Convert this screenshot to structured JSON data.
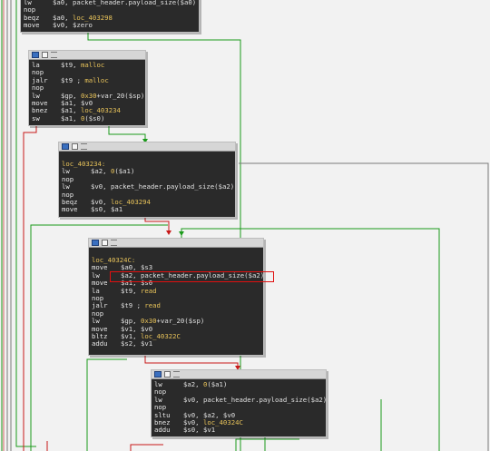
{
  "blocks": [
    {
      "id": "top",
      "lines": [
        {
          "m": "lw",
          "o": "$a0, packet_header.payload_size($a0)"
        },
        {
          "m": "nop",
          "o": ""
        },
        {
          "m": "beqz",
          "o": "$a0, loc_403298"
        },
        {
          "m": "move",
          "o": "$v0, $zero"
        }
      ]
    },
    {
      "id": "malloc",
      "lines": [
        {
          "m": "la",
          "o": "$t9, malloc"
        },
        {
          "m": "nop",
          "o": ""
        },
        {
          "m": "jalr",
          "o": "$t9 ; malloc"
        },
        {
          "m": "nop",
          "o": ""
        },
        {
          "m": "lw",
          "o": "$gp, 0x30+var_20($sp)"
        },
        {
          "m": "move",
          "o": "$a1, $v0"
        },
        {
          "m": "bnez",
          "o": "$a1, loc_403234"
        },
        {
          "m": "sw",
          "o": "$a1, 0($s0)"
        }
      ]
    },
    {
      "id": "loc403234",
      "lines": [
        {
          "m": "loc_403234:",
          "o": "",
          "label": true
        },
        {
          "m": "lw",
          "o": "$a2, 0($a1)"
        },
        {
          "m": "nop",
          "o": ""
        },
        {
          "m": "lw",
          "o": "$v0, packet_header.payload_size($a2)"
        },
        {
          "m": "nop",
          "o": ""
        },
        {
          "m": "beqz",
          "o": "$v0, loc_403294"
        },
        {
          "m": "move",
          "o": "$s0, $a1"
        }
      ]
    },
    {
      "id": "loc40324c",
      "lines": [
        {
          "m": "loc_40324C:",
          "o": "",
          "label": true
        },
        {
          "m": "move",
          "o": "$a0, $s3"
        },
        {
          "m": "lw",
          "o": "$a2, packet_header.payload_size($a2)"
        },
        {
          "m": "move",
          "o": "$a1, $s0"
        },
        {
          "m": "la",
          "o": "$t9, read"
        },
        {
          "m": "nop",
          "o": ""
        },
        {
          "m": "jalr",
          "o": "$t9 ; read"
        },
        {
          "m": "nop",
          "o": ""
        },
        {
          "m": "lw",
          "o": "$gp, 0x30+var_20($sp)"
        },
        {
          "m": "move",
          "o": "$v1, $v0"
        },
        {
          "m": "bltz",
          "o": "$v1, loc_40322C"
        },
        {
          "m": "addu",
          "o": "$s2, $v1"
        }
      ]
    },
    {
      "id": "bottom",
      "lines": [
        {
          "m": "lw",
          "o": "$a2, 0($a1)"
        },
        {
          "m": "nop",
          "o": ""
        },
        {
          "m": "lw",
          "o": "$v0, packet_header.payload_size($a2)"
        },
        {
          "m": "nop",
          "o": ""
        },
        {
          "m": "sltu",
          "o": "$v0, $a2, $v0"
        },
        {
          "m": "bnez",
          "o": "$v0, loc_40324C"
        },
        {
          "m": "addu",
          "o": "$s0, $v1"
        }
      ]
    }
  ],
  "colors": {
    "edge_green": "#1a9a1a",
    "edge_red": "#c81818",
    "edge_gray": "#7a7a7a",
    "block_bg": "#2a2a2a",
    "highlight": "#e01010"
  }
}
